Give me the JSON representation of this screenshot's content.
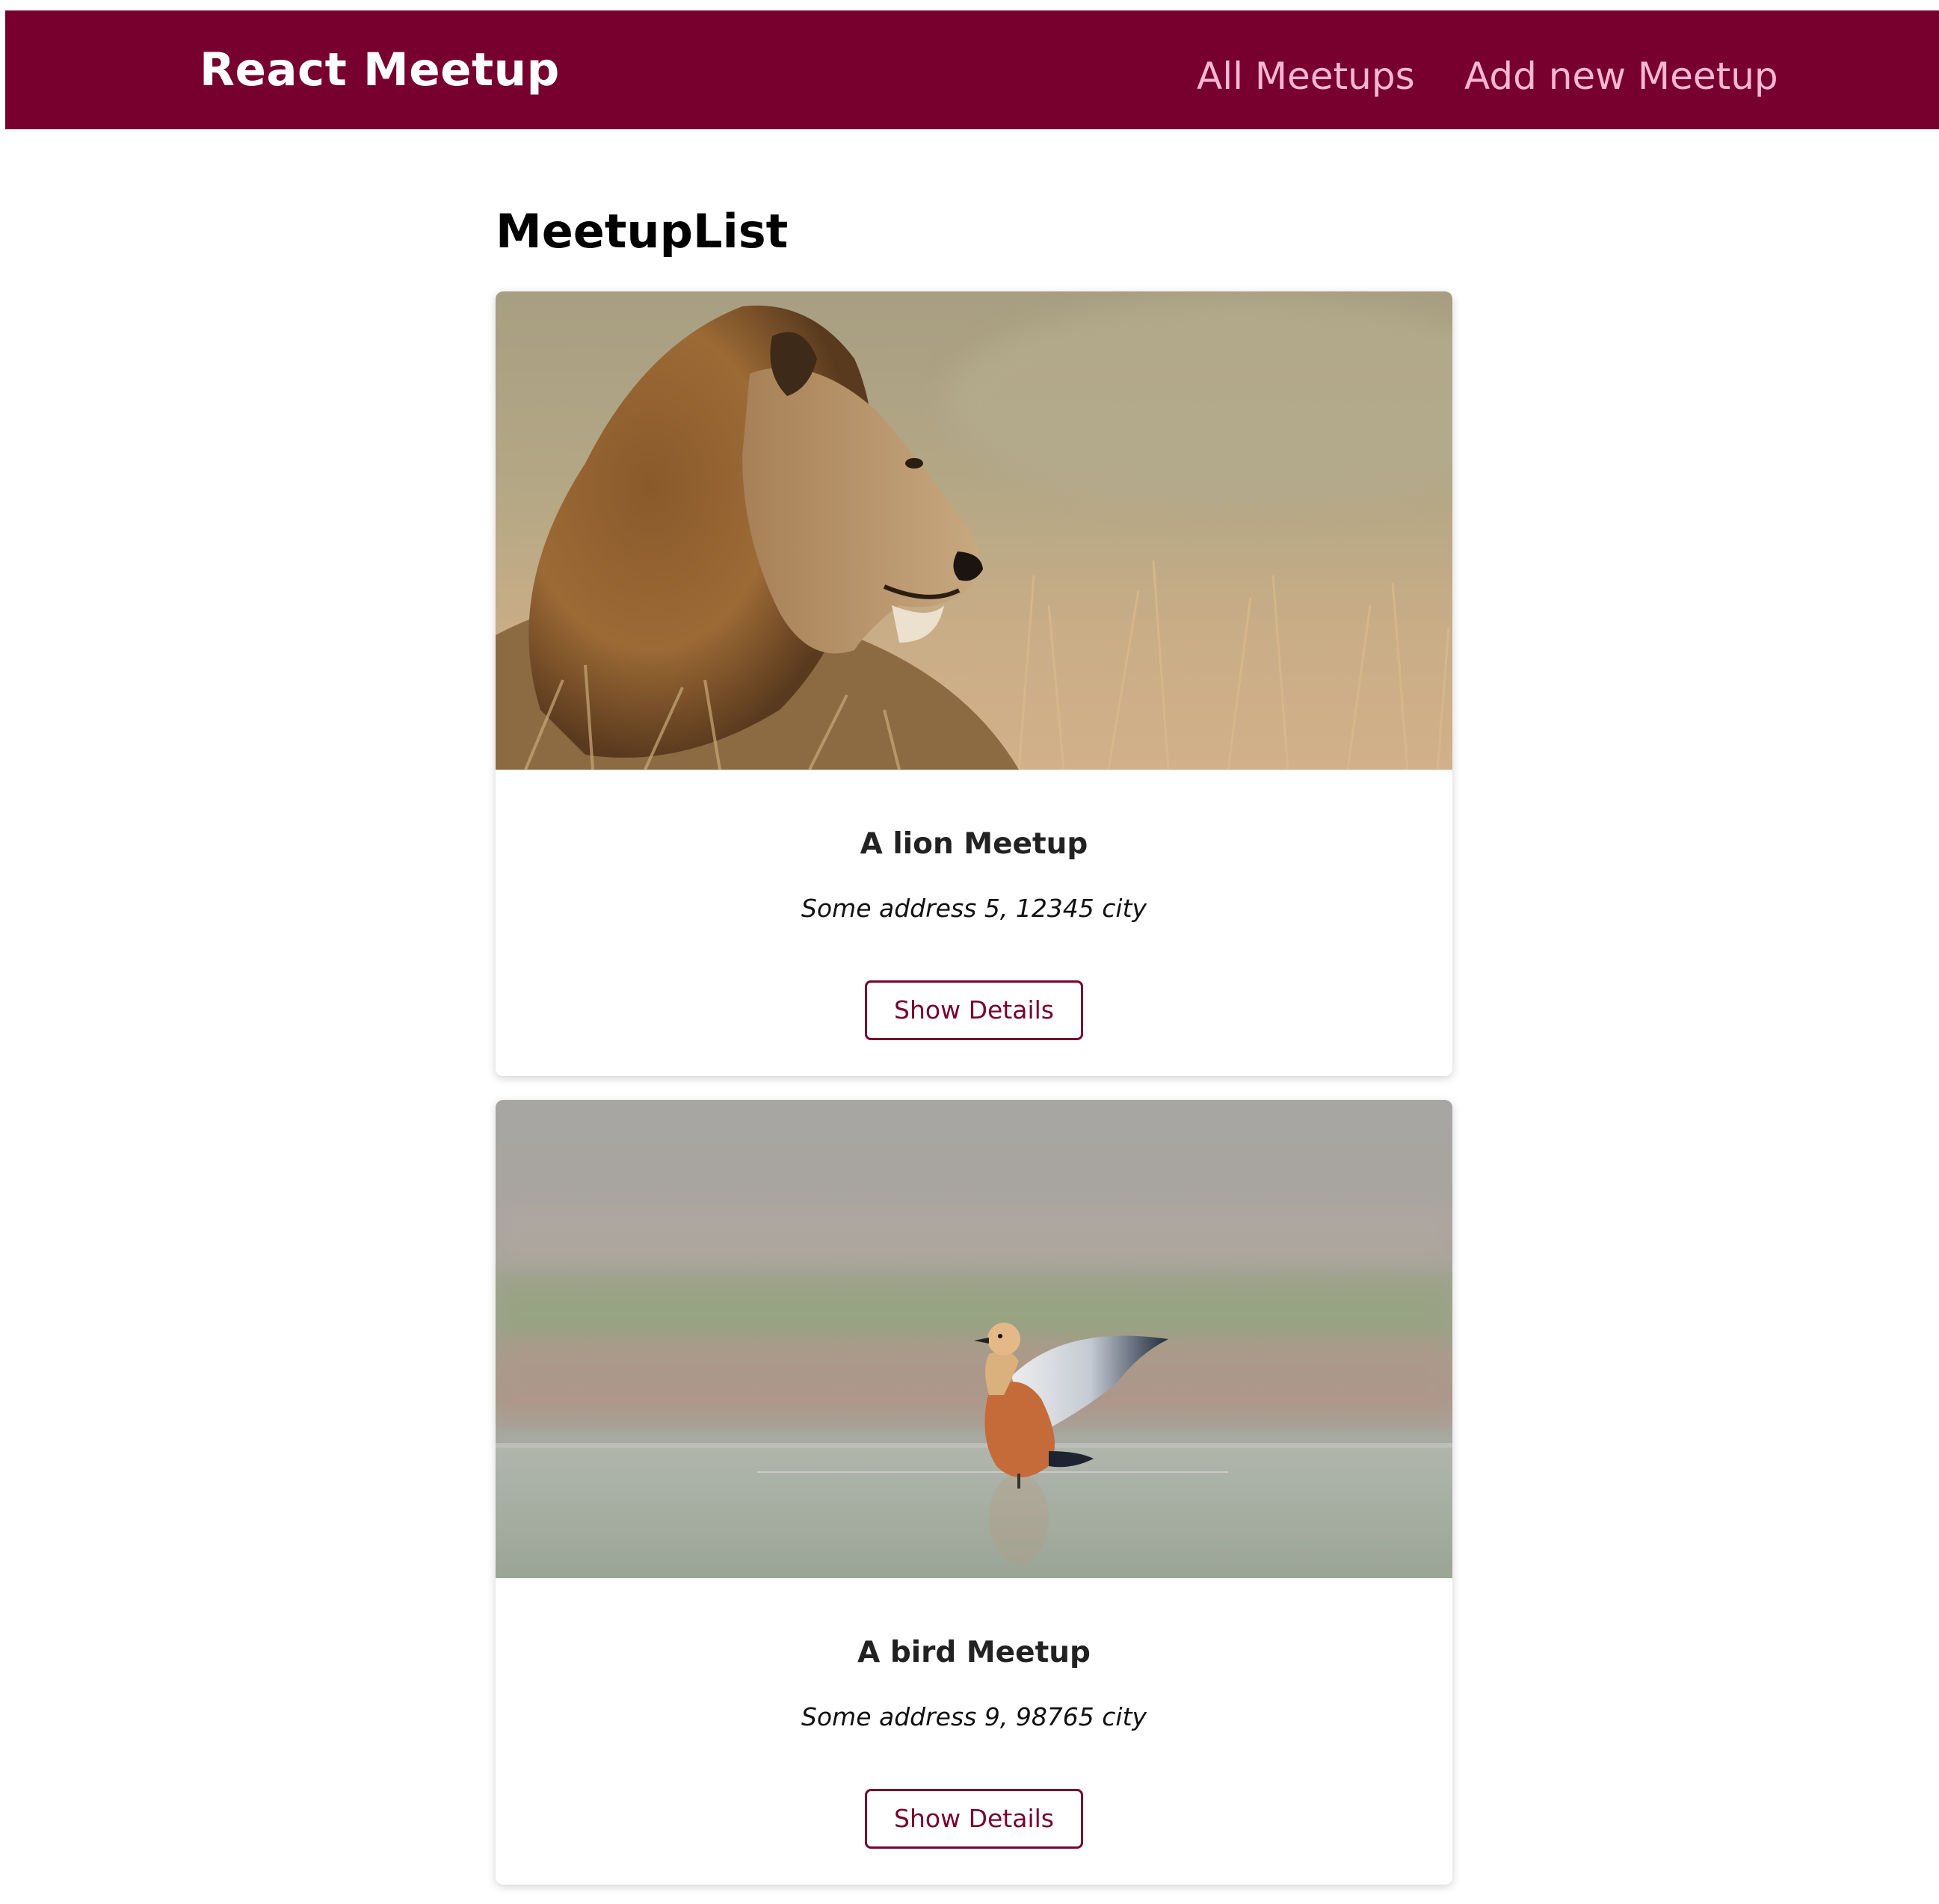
{
  "header": {
    "logo": "React Meetup",
    "nav": [
      {
        "label": "All Meetups"
      },
      {
        "label": "Add new Meetup"
      }
    ],
    "background_color": "#77002e",
    "link_color": "#fcb8d2"
  },
  "main": {
    "title": "MeetupList",
    "meetups": [
      {
        "image_icon": "lion-photo",
        "title": "A lion Meetup",
        "address": "Some address 5, 12345 city",
        "button_label": "Show Details"
      },
      {
        "image_icon": "bird-photo",
        "title": "A bird Meetup",
        "address": "Some address 9, 98765 city",
        "button_label": "Show Details"
      }
    ]
  },
  "colors": {
    "accent": "#77002e"
  }
}
